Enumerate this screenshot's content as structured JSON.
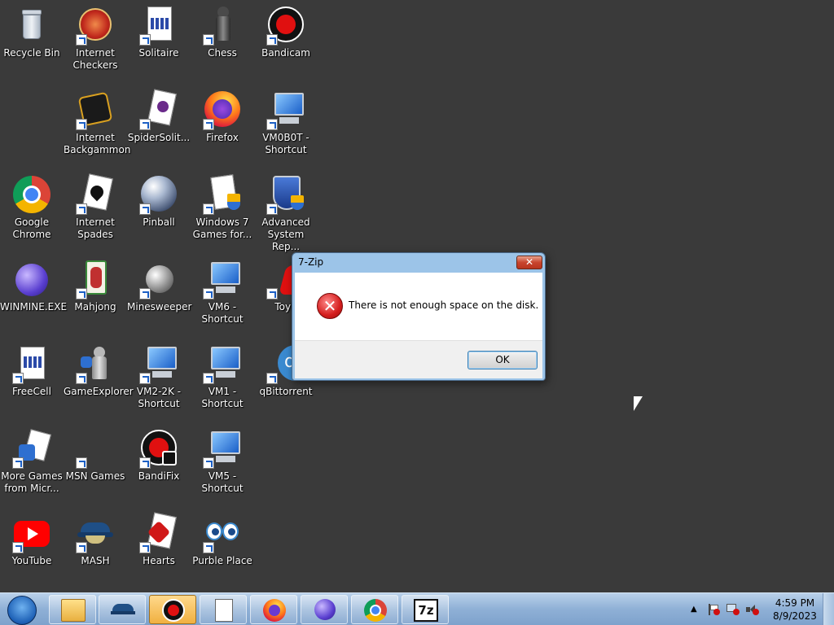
{
  "desktop": {
    "icons": [
      {
        "label": "Recycle Bin",
        "icon": "recycle-bin-icon"
      },
      {
        "label": "Internet Checkers",
        "icon": "internet-checkers-icon"
      },
      {
        "label": "Solitaire",
        "icon": "solitaire-icon"
      },
      {
        "label": "Chess",
        "icon": "chess-icon"
      },
      {
        "label": "Bandicam",
        "icon": "bandicam-icon"
      },
      {
        "label": "Internet Backgammon",
        "icon": "internet-backgammon-icon"
      },
      {
        "label": "SpiderSolit...",
        "icon": "spider-solitaire-icon"
      },
      {
        "label": "Firefox",
        "icon": "firefox-icon"
      },
      {
        "label": "VM0B0T - Shortcut",
        "icon": "computer-shortcut-icon"
      },
      {
        "label": "Google Chrome",
        "icon": "chrome-icon"
      },
      {
        "label": "Internet Spades",
        "icon": "internet-spades-icon"
      },
      {
        "label": "Pinball",
        "icon": "pinball-icon"
      },
      {
        "label": "Windows 7 Games for...",
        "icon": "windows7-games-icon"
      },
      {
        "label": "Advanced System Rep...",
        "icon": "advanced-system-repair-icon"
      },
      {
        "label": "WINMINE.EXE",
        "icon": "winmine-icon"
      },
      {
        "label": "Mahjong",
        "icon": "mahjong-icon"
      },
      {
        "label": "Minesweeper",
        "icon": "minesweeper-icon"
      },
      {
        "label": "VM6 - Shortcut",
        "icon": "computer-shortcut-icon"
      },
      {
        "label": "Toyb",
        "icon": "toyb-icon"
      },
      {
        "label": "FreeCell",
        "icon": "freecell-icon"
      },
      {
        "label": "GameExplorer",
        "icon": "game-explorer-icon"
      },
      {
        "label": "VM2-2K - Shortcut",
        "icon": "computer-shortcut-icon"
      },
      {
        "label": "VM1 - Shortcut",
        "icon": "computer-shortcut-icon"
      },
      {
        "label": "qBittorrent",
        "icon": "qbittorrent-icon"
      },
      {
        "label": "More Games from Micr...",
        "icon": "more-games-icon"
      },
      {
        "label": "MSN Games",
        "icon": "msn-games-icon"
      },
      {
        "label": "BandiFix",
        "icon": "bandifix-icon"
      },
      {
        "label": "VM5 - Shortcut",
        "icon": "computer-shortcut-icon"
      },
      {
        "label": "YouTube",
        "icon": "youtube-icon"
      },
      {
        "label": "MASH",
        "icon": "mash-icon"
      },
      {
        "label": "Hearts",
        "icon": "hearts-icon"
      },
      {
        "label": "Purble Place",
        "icon": "purble-place-icon"
      }
    ]
  },
  "dialog": {
    "title": "7-Zip",
    "close_label": "✕",
    "message": "There is not enough space on the disk.",
    "ok_label": "OK",
    "icon": "error-icon"
  },
  "taskbar": {
    "pinned": [
      {
        "icon": "explorer-icon"
      },
      {
        "icon": "mash-icon"
      },
      {
        "icon": "bandicam-icon",
        "active": true
      },
      {
        "icon": "notepad-icon"
      },
      {
        "icon": "firefox-icon"
      },
      {
        "icon": "winmine-icon"
      },
      {
        "icon": "chrome-icon"
      },
      {
        "icon": "7zip-icon",
        "text": "7z"
      }
    ],
    "tray": {
      "arrow": "▲",
      "time": "4:59 PM",
      "date": "8/9/2023"
    }
  }
}
